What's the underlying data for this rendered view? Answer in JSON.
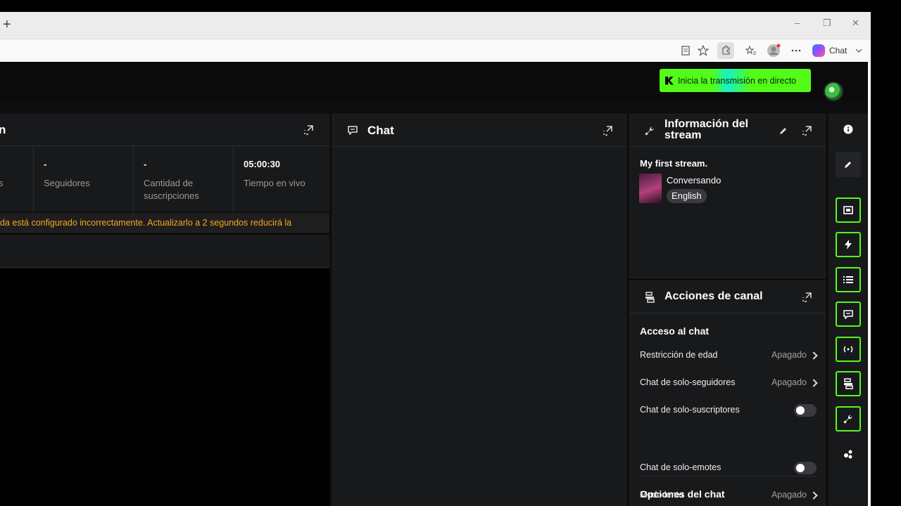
{
  "browser": {
    "new_tab_symbol": "+",
    "window_controls": [
      "–",
      "❐",
      "✕"
    ],
    "toolbar_chat_label": "Chat"
  },
  "nav": {
    "go_live_label": "Inicia la transmisión en directo"
  },
  "stats_panel": {
    "title_fragment": "n",
    "stats": [
      {
        "value": "",
        "label": "s"
      },
      {
        "value": "-",
        "label": "Seguidores"
      },
      {
        "value": "-",
        "label": "Cantidad de suscripciones"
      },
      {
        "value": "05:00:30",
        "label": "Tiempo en vivo"
      }
    ],
    "warning": "da está configurado incorrectamente. Actualizarlo a 2 segundos reducirá la"
  },
  "chat_panel": {
    "title": "Chat"
  },
  "stream_info": {
    "title": "Información del stream",
    "stream_title": "My first stream.",
    "category": "Conversando",
    "language_tag": "English"
  },
  "channel_actions": {
    "title": "Acciones de canal",
    "section_chat_access": "Acceso al chat",
    "rows_access": [
      {
        "label": "Restricción de edad",
        "value": "Apagado",
        "type": "link"
      },
      {
        "label": "Chat de solo-seguidores",
        "value": "Apagado",
        "type": "link"
      },
      {
        "label": "Chat de solo-suscriptores",
        "value": "",
        "type": "toggle",
        "on": false
      }
    ],
    "section_chat_options": "Opciones del chat",
    "rows_options": [
      {
        "label": "Chat de solo-emotes",
        "value": "",
        "type": "toggle",
        "on": false
      },
      {
        "label": "Modo lento",
        "value": "Apagado",
        "type": "link"
      }
    ]
  },
  "colors": {
    "accent": "#53fc18",
    "warning": "#f5a623",
    "panel": "#18191b"
  },
  "rail_icons": [
    "info-icon",
    "edit-icon",
    "video-icon",
    "lightning-icon",
    "list-icon",
    "chat-icon",
    "broadcast-icon",
    "channel-actions-icon",
    "wrench-icon",
    "more-icon"
  ]
}
